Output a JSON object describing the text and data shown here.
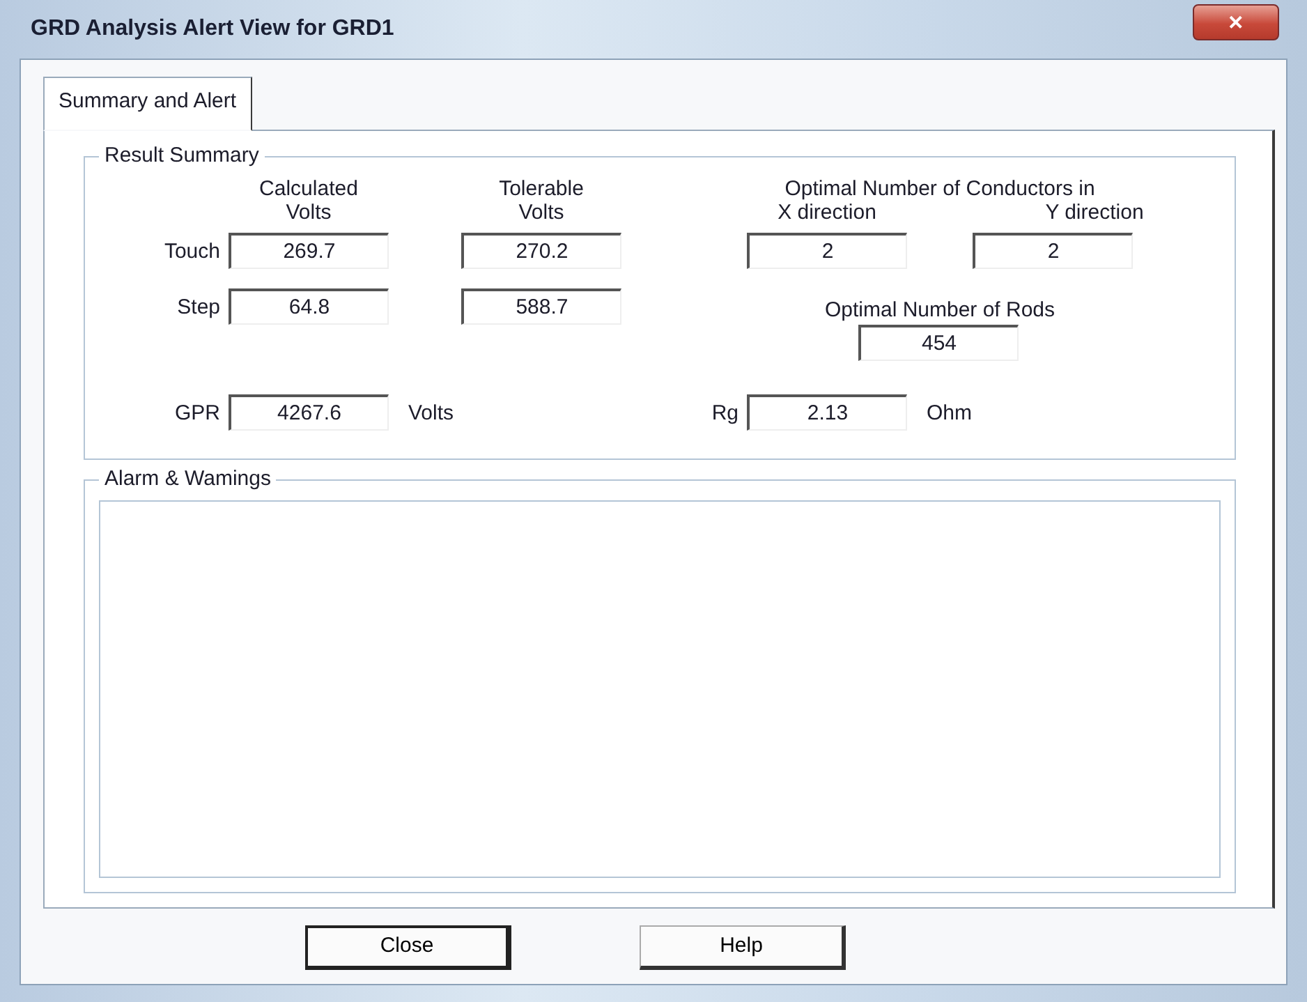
{
  "window": {
    "title": "GRD Analysis Alert View for GRD1",
    "close_symbol": "✕"
  },
  "tabs": [
    {
      "label": "Summary and Alert",
      "selected": true
    }
  ],
  "result_summary": {
    "legend": "Result Summary",
    "calculated_header": "Calculated\nVolts",
    "tolerable_header": "Tolerable\nVolts",
    "rows": [
      {
        "label": "Touch",
        "calculated": "269.7",
        "tolerable": "270.2"
      },
      {
        "label": "Step",
        "calculated": "64.8",
        "tolerable": "588.7"
      }
    ],
    "conductors": {
      "header": "Optimal Number of Conductors in",
      "x_label": "X direction",
      "y_label": "Y direction",
      "x_value": "2",
      "y_value": "2"
    },
    "rods": {
      "label": "Optimal Number of Rods",
      "value": "454"
    },
    "gpr": {
      "label": "GPR",
      "value": "4267.6",
      "unit": "Volts"
    },
    "rg": {
      "label": "Rg",
      "value": "2.13",
      "unit": "Ohm"
    }
  },
  "alarms": {
    "legend": "Alarm & Wamings"
  },
  "buttons": [
    {
      "label": "Close",
      "default": true
    },
    {
      "label": "Help",
      "default": false
    }
  ]
}
